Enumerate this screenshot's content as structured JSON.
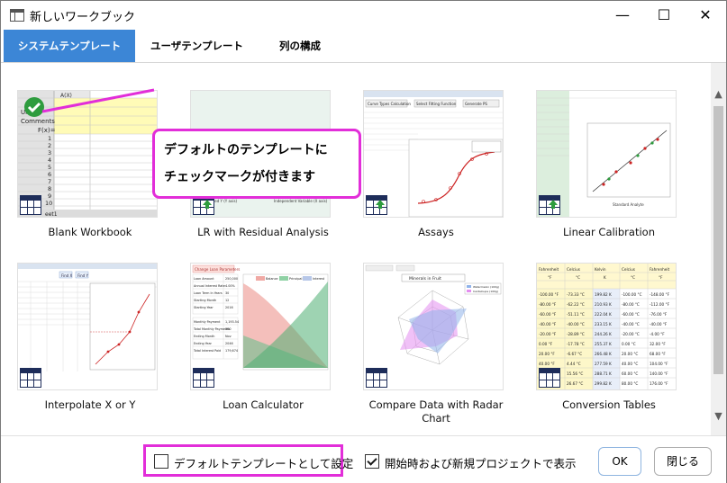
{
  "window": {
    "title": "新しいワークブック",
    "minimize": "—",
    "maximize": "☐",
    "close": "✕"
  },
  "tabs": [
    {
      "label": "システムテンプレート",
      "active": true
    },
    {
      "label": "ユーザテンプレート",
      "active": false
    },
    {
      "label": "列の構成",
      "active": false
    }
  ],
  "callout": {
    "line1": "デフォルトのテンプレートに",
    "line2": "チェックマークが付きます"
  },
  "templates": [
    {
      "label": "Blank Workbook",
      "selected": true,
      "icon": "worksheet-grid-icon",
      "preview": {
        "col_a": "A(X)",
        "rows": [
          "Long Name",
          "Units",
          "Comments",
          "F(x)=",
          "1",
          "2",
          "3",
          "4",
          "5",
          "6",
          "7",
          "8",
          "9",
          "10",
          "11"
        ],
        "sheet_tab": "eet1"
      }
    },
    {
      "label": "LR with Residual Analysis",
      "selected": false,
      "icon": "worksheet-grid-icon",
      "preview": {
        "caption_left": "Fitted Y (Y axis)",
        "caption_right": "Independent Variable (X axis)"
      }
    },
    {
      "label": "Assays",
      "selected": false,
      "icon": "worksheet-grid-icon",
      "preview": {
        "menu": [
          "Curve Types Calculation",
          "Select Fitting Function",
          "Generate PS"
        ]
      }
    },
    {
      "label": "Linear Calibration",
      "selected": false,
      "icon": "worksheet-grid-icon",
      "preview": {
        "caption": "Standard Analyte"
      }
    },
    {
      "label": "Interpolate X or Y",
      "selected": false,
      "icon": "worksheet-grid-icon",
      "preview": {
        "buttons": [
          "Find X",
          "Find Y"
        ]
      }
    },
    {
      "label": "Loan Calculator",
      "selected": false,
      "icon": "worksheet-grid-icon",
      "preview": {
        "tag": "Change Loan Parameters",
        "rows": [
          "Loan Amount",
          "Annual Interest Rate",
          "Loan Term In Years",
          "Starting Month",
          "Starting Year",
          "Monthly Payment",
          "Total Monthly Payments",
          "Ending Month",
          "Ending Year",
          "Total Interest Paid"
        ],
        "values": [
          "250,000",
          "4.00%",
          "30",
          "12",
          "2016",
          "1,193.54",
          "360",
          "Nov",
          "2046",
          "179,674"
        ],
        "legend": [
          "Balance",
          "Principal",
          "Interest"
        ]
      }
    },
    {
      "label": "Compare Data with Radar Chart",
      "selected": false,
      "icon": "worksheet-grid-icon",
      "preview": {
        "title": "Minerals in Fruit",
        "legend": [
          "Watermelon (100g)",
          "Cantaloupe (100g)"
        ]
      }
    },
    {
      "label": "Conversion Tables",
      "selected": false,
      "icon": "worksheet-grid-icon",
      "preview": {
        "headers": [
          "Fahrenheit",
          "Celcius",
          "Kelvin",
          "Celcius",
          "Fahrenheit"
        ],
        "units": [
          "°F",
          "°C",
          "K",
          "°C",
          "°F"
        ],
        "rows": [
          [
            "-100.00 °F",
            "-73.33 °C",
            "199.82 K",
            "-100.00 °C",
            "-148.00 °F"
          ],
          [
            "-80.00 °F",
            "-62.22 °C",
            "210.93 K",
            "-80.00 °C",
            "-112.00 °F"
          ],
          [
            "-60.00 °F",
            "-51.11 °C",
            "222.04 K",
            "-60.00 °C",
            "-76.00 °F"
          ],
          [
            "-40.00 °F",
            "-40.00 °C",
            "233.15 K",
            "-40.00 °C",
            "-40.00 °F"
          ],
          [
            "-20.00 °F",
            "-28.89 °C",
            "244.26 K",
            "-20.00 °C",
            "-4.00 °F"
          ],
          [
            "0.00 °F",
            "-17.78 °C",
            "255.37 K",
            "0.00 °C",
            "32.00 °F"
          ],
          [
            "20.00 °F",
            "-6.67 °C",
            "266.48 K",
            "20.00 °C",
            "68.00 °F"
          ],
          [
            "40.00 °F",
            "4.44 °C",
            "277.59 K",
            "40.00 °C",
            "104.00 °F"
          ],
          [
            "60.00 °F",
            "15.56 °C",
            "288.71 K",
            "60.00 °C",
            "140.00 °F"
          ],
          [
            "80.00 °F",
            "26.67 °C",
            "299.82 K",
            "80.00 °C",
            "176.00 °F"
          ]
        ]
      }
    }
  ],
  "footer": {
    "set_default_label": "デフォルトテンプレートとして設定",
    "set_default_checked": false,
    "show_on_start_label": "開始時および新規プロジェクトで表示",
    "show_on_start_checked": true,
    "ok_label": "OK",
    "close_label": "閉じる"
  },
  "colors": {
    "accent": "#3c86d6",
    "callout_border": "#e22ed9",
    "check_green": "#2e9c3e"
  }
}
